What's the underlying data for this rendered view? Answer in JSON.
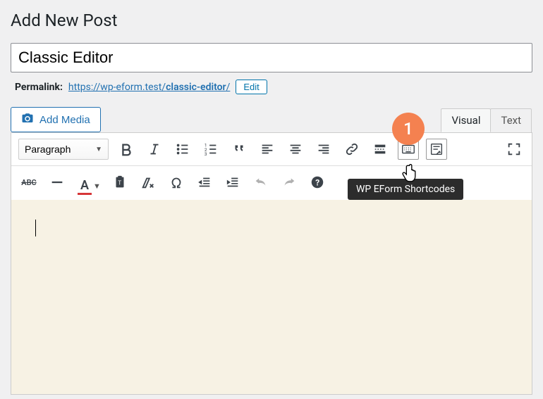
{
  "page": {
    "heading": "Add New Post",
    "title_value": "Classic Editor"
  },
  "permalink": {
    "label": "Permalink:",
    "url_base": "https://wp-eform.test/",
    "slug": "classic-editor",
    "trail": "/",
    "edit_label": "Edit"
  },
  "media": {
    "add_media_label": "Add Media"
  },
  "tabs": {
    "visual": "Visual",
    "text": "Text",
    "active": "visual"
  },
  "toolbar": {
    "format_select": "Paragraph",
    "row1": [
      {
        "name": "bold",
        "label": "Bold"
      },
      {
        "name": "italic",
        "label": "Italic"
      },
      {
        "name": "bullist",
        "label": "Bulleted list"
      },
      {
        "name": "numlist",
        "label": "Numbered list"
      },
      {
        "name": "blockquote",
        "label": "Blockquote"
      },
      {
        "name": "alignleft",
        "label": "Align left"
      },
      {
        "name": "aligncenter",
        "label": "Align center"
      },
      {
        "name": "alignright",
        "label": "Align right"
      },
      {
        "name": "link",
        "label": "Insert link"
      },
      {
        "name": "more",
        "label": "Read more"
      },
      {
        "name": "keyboard",
        "label": "Keyboard"
      },
      {
        "name": "eform",
        "label": "WP EForm Shortcodes"
      }
    ],
    "fullscreen": "Fullscreen",
    "row2": [
      {
        "name": "strike",
        "label": "Strikethrough"
      },
      {
        "name": "hr",
        "label": "Horizontal line"
      },
      {
        "name": "textcolor",
        "label": "Text color"
      },
      {
        "name": "paste",
        "label": "Paste as text"
      },
      {
        "name": "clear",
        "label": "Clear formatting"
      },
      {
        "name": "special",
        "label": "Special character"
      },
      {
        "name": "outdent",
        "label": "Outdent"
      },
      {
        "name": "indent",
        "label": "Indent"
      },
      {
        "name": "undo",
        "label": "Undo"
      },
      {
        "name": "redo",
        "label": "Redo"
      },
      {
        "name": "help",
        "label": "Help"
      }
    ]
  },
  "tooltip": {
    "text": "WP EForm Shortcodes"
  },
  "callout": {
    "number": "1"
  },
  "content": ""
}
